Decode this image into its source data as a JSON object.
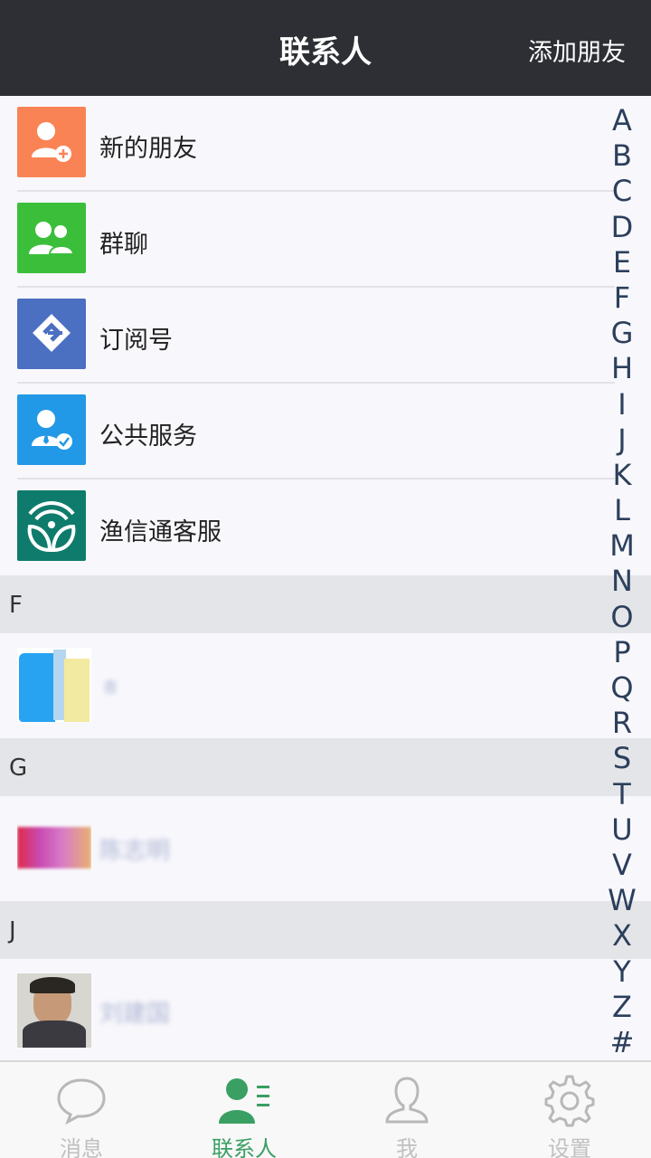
{
  "header": {
    "title": "联系人",
    "add_friend": "添加朋友"
  },
  "feature_rows": [
    {
      "label": "新的朋友",
      "icon": "add-user-icon",
      "color": "#fa8356"
    },
    {
      "label": "群聊",
      "icon": "group-icon",
      "color": "#3bbf3b"
    },
    {
      "label": "订阅号",
      "icon": "subscription-icon",
      "color": "#4b6fc1"
    },
    {
      "label": "公共服务",
      "icon": "verified-user-icon",
      "color": "#2299e6"
    },
    {
      "label": "渔信通客服",
      "icon": "fishery-service-logo",
      "color": "#0f7b6c"
    }
  ],
  "sections": [
    {
      "letter": "F",
      "contact_name": "ㅎ"
    },
    {
      "letter": "G",
      "contact_name": "陈志明"
    },
    {
      "letter": "J",
      "contact_name": "刘建国"
    }
  ],
  "index_letters": [
    "A",
    "B",
    "C",
    "D",
    "E",
    "F",
    "G",
    "H",
    "I",
    "J",
    "K",
    "L",
    "M",
    "N",
    "O",
    "P",
    "Q",
    "R",
    "S",
    "T",
    "U",
    "V",
    "W",
    "X",
    "Y",
    "Z",
    "#"
  ],
  "tabs": [
    {
      "label": "消息",
      "icon": "chat-bubble-icon",
      "active": false
    },
    {
      "label": "联系人",
      "icon": "contacts-icon",
      "active": true
    },
    {
      "label": "我",
      "icon": "person-icon",
      "active": false
    },
    {
      "label": "设置",
      "icon": "gear-icon",
      "active": false
    }
  ],
  "colors": {
    "accent": "#3a9f63",
    "header_bg": "#2e2f34",
    "section_bg": "#e4e5e8"
  }
}
